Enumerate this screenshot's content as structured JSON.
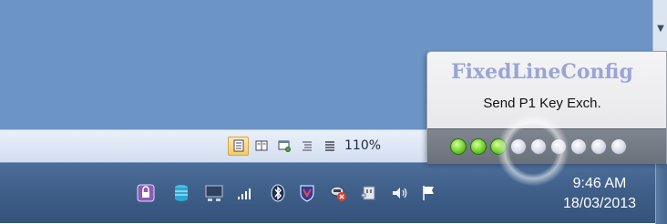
{
  "window": {
    "scrollbar_icon": "scroll-down-arrow-icon"
  },
  "status_bar": {
    "view_buttons": [
      {
        "icon": "print-layout-icon",
        "active": true
      },
      {
        "icon": "full-screen-reading-icon",
        "active": false
      },
      {
        "icon": "web-layout-icon",
        "active": false
      },
      {
        "icon": "outline-icon",
        "active": false
      },
      {
        "icon": "draft-icon",
        "active": false
      }
    ],
    "zoom_text": "110%"
  },
  "popup": {
    "title": "FixedLineConfig",
    "message": "Send P1 Key Exch.",
    "progress": {
      "completed": 3,
      "total": 9
    },
    "colors": {
      "title": "#9aa5d6",
      "dot_on": "#6fd22a",
      "dot_off": "#d9dbe6"
    }
  },
  "taskbar": {
    "tray_icons": [
      "security-lock-icon",
      "database-sync-icon",
      "network-monitor-icon",
      "signal-strength-icon",
      "bluetooth-icon",
      "antivirus-shield-icon",
      "network-error-icon",
      "usb-device-icon",
      "volume-icon",
      "action-center-flag-icon"
    ],
    "clock": {
      "time": "9:46 AM",
      "date": "18/03/2013"
    }
  }
}
